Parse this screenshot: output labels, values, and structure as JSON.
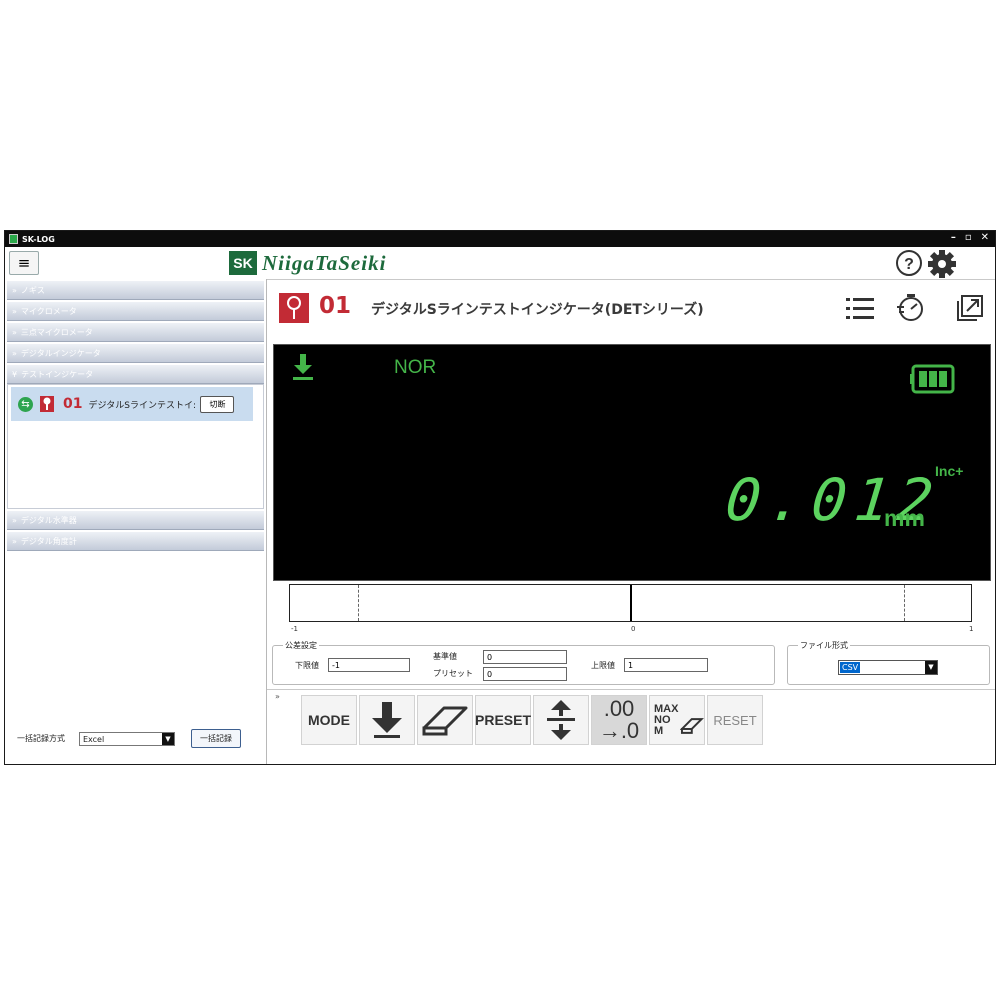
{
  "window": {
    "title": "SK-LOG",
    "controls": [
      "–",
      "▫",
      "✕"
    ]
  },
  "header": {
    "menu_label": "≡",
    "brand_mark": "SK",
    "brand_name": "NiigaTaSeiki",
    "help_icon": "question-circle-icon",
    "settings_icon": "gear-icon"
  },
  "sidebar": {
    "categories": [
      {
        "label": "ノギス"
      },
      {
        "label": "マイクロメータ"
      },
      {
        "label": "三点マイクロメータ"
      },
      {
        "label": "デジタルインジケータ"
      },
      {
        "label": "テストインジケータ"
      },
      {
        "label": "デジタル水準器"
      },
      {
        "label": "デジタル角度計"
      }
    ],
    "expanded_category": "テストインジケータ",
    "device": {
      "number": "01",
      "name": "デジタルSラインテストイ:",
      "disconnect_label": "切断"
    },
    "bulk_record": {
      "label": "一括記録方式",
      "format": "Excel",
      "button_label": "一括記録"
    }
  },
  "device_header": {
    "number": "01",
    "title": "デジタルSラインテストインジケータ(DETシリーズ)",
    "icons": [
      "list-icon",
      "timer-icon",
      "popout-icon"
    ]
  },
  "display": {
    "mode": "NOR",
    "direction": "Inc+",
    "value": "0.012",
    "unit": "mm",
    "battery_level": "full",
    "accent_color": "#44b549"
  },
  "scale": {
    "min": "-1",
    "center": "0",
    "max": "1"
  },
  "tolerance": {
    "legend": "公差設定",
    "lower_label": "下限値",
    "lower_value": "-1",
    "base_label": "基準値",
    "base_value": "0",
    "preset_label": "プリセット",
    "preset_value": "0",
    "upper_label": "上限値",
    "upper_value": "1"
  },
  "file_format": {
    "legend": "ファイル形式",
    "value": "CSV"
  },
  "toolbar": {
    "collapse": "»",
    "mode_label": "MODE",
    "preset_label": "PRESET",
    "resolution_top": ".00",
    "resolution_bottom": "→.0",
    "maxnom_label": "MAX\nNO\nM",
    "reset_label": "RESET"
  },
  "colors": {
    "brand_green": "#1d6a3c",
    "device_red": "#c22b35",
    "display_green": "#5cd35f"
  }
}
